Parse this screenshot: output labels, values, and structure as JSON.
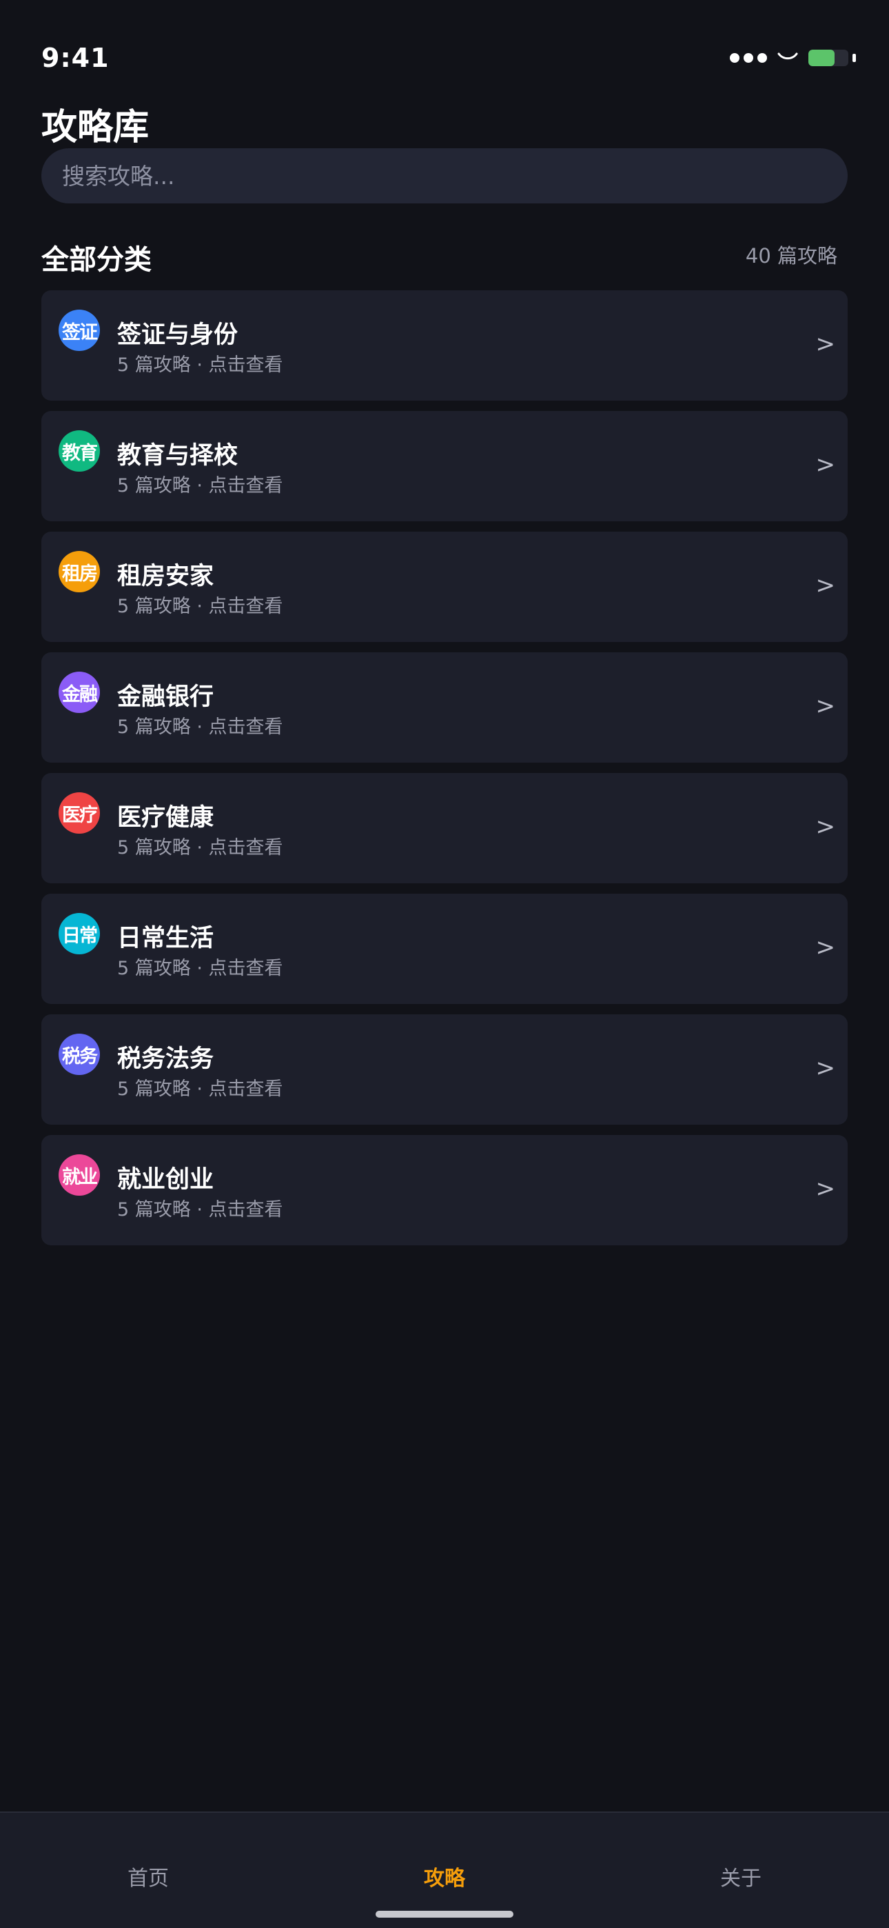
{
  "status_bar": {
    "time": "9:41",
    "battery_level": 0.65,
    "icons": [
      "signal-dots-icon",
      "wifi-icon",
      "battery-icon"
    ]
  },
  "header": {
    "title": "攻略库",
    "search_placeholder": "搜索攻略..."
  },
  "section": {
    "title": "全部分类",
    "count": "40 篇攻略"
  },
  "categories": [
    {
      "badge": "签证",
      "name": "签证与身份",
      "meta": "5 篇攻略 · 点击查看",
      "color": "#3b82f6"
    },
    {
      "badge": "教育",
      "name": "教育与择校",
      "meta": "5 篇攻略 · 点击查看",
      "color": "#10b981"
    },
    {
      "badge": "租房",
      "name": "租房安家",
      "meta": "5 篇攻略 · 点击查看",
      "color": "#f59e0b"
    },
    {
      "badge": "金融",
      "name": "金融银行",
      "meta": "5 篇攻略 · 点击查看",
      "color": "#8b5cf6"
    },
    {
      "badge": "医疗",
      "name": "医疗健康",
      "meta": "5 篇攻略 · 点击查看",
      "color": "#ef4444"
    },
    {
      "badge": "日常",
      "name": "日常生活",
      "meta": "5 篇攻略 · 点击查看",
      "color": "#06b6d4"
    },
    {
      "badge": "税务",
      "name": "税务法务",
      "meta": "5 篇攻略 · 点击查看",
      "color": "#6366f1"
    },
    {
      "badge": "就业",
      "name": "就业创业",
      "meta": "5 篇攻略 · 点击查看",
      "color": "#ec4899"
    }
  ],
  "chevron": ">",
  "tabs": [
    {
      "label": "首页",
      "active": false
    },
    {
      "label": "攻略",
      "active": true
    },
    {
      "label": "关于",
      "active": false
    }
  ],
  "colors": {
    "background": "#111218",
    "card": "#1d1f2b",
    "accent": "#f59e0b"
  }
}
